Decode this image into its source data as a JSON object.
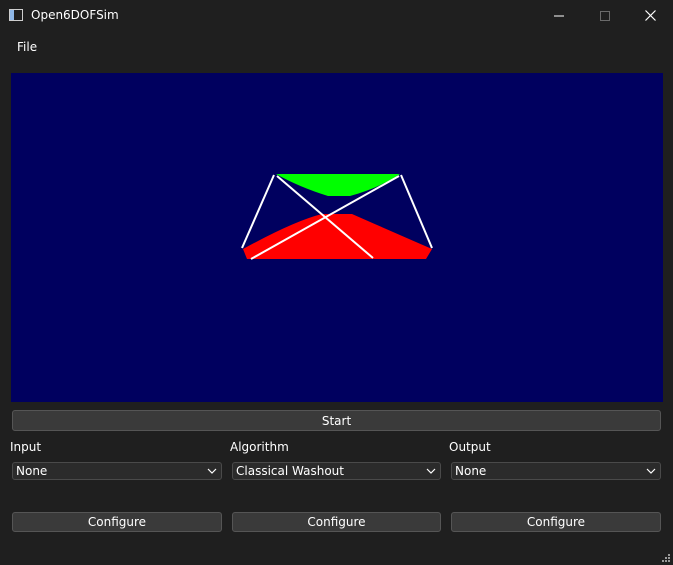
{
  "window": {
    "title": "Open6DOFSim",
    "icon": "app-window-icon",
    "controls": [
      "minimize-icon",
      "maximize-icon",
      "close-icon"
    ]
  },
  "menu": {
    "items": [
      {
        "label": "File"
      }
    ]
  },
  "viewport": {
    "background": "#00005f",
    "platform_top_color": "#00ff00",
    "platform_base_color": "#ff0000",
    "actuator_color": "#ffffff"
  },
  "controls": {
    "start_label": "Start",
    "input": {
      "label": "Input",
      "value": "None"
    },
    "algorithm": {
      "label": "Algorithm",
      "value": "Classical Washout"
    },
    "output": {
      "label": "Output",
      "value": "None"
    },
    "configure_label": "Configure"
  }
}
